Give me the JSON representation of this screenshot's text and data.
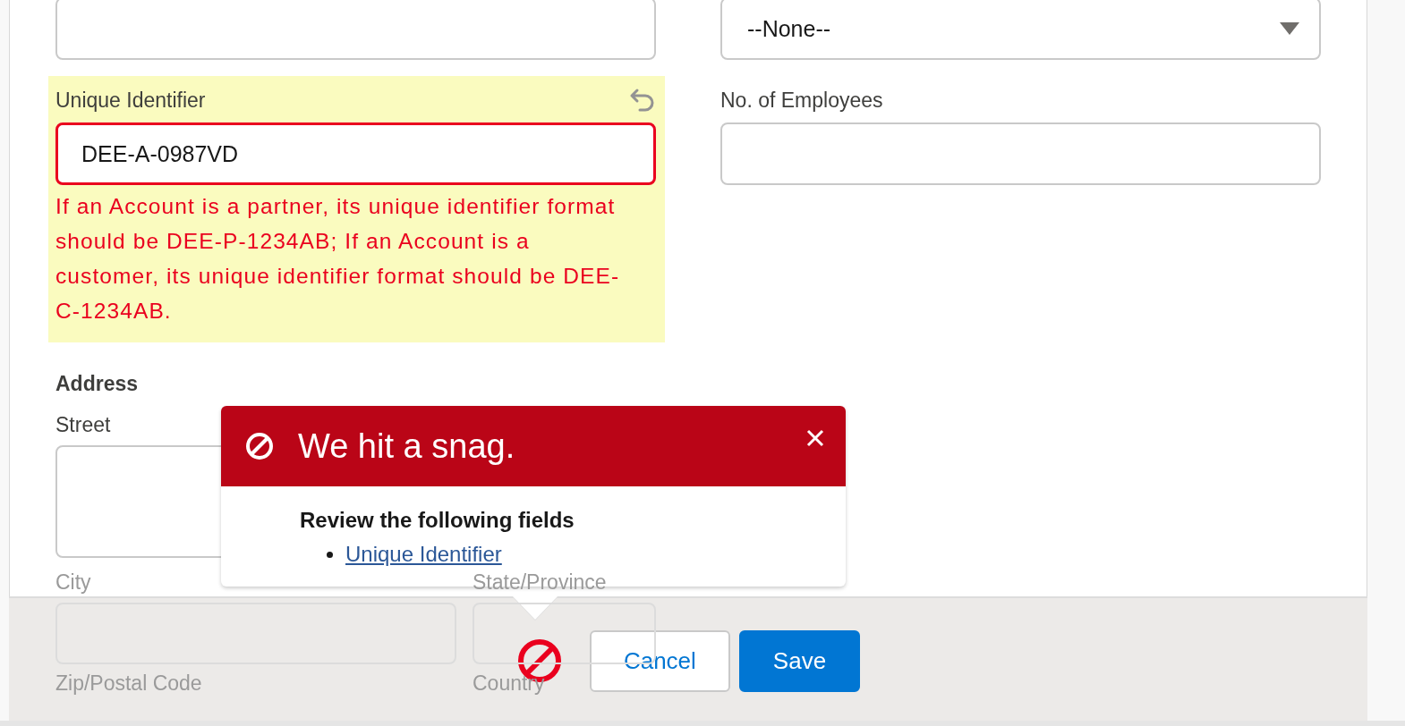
{
  "form": {
    "top_right_select": {
      "value": "--None--"
    },
    "unique_identifier": {
      "label": "Unique Identifier",
      "value": "DEE-A-0987VD",
      "changed": true,
      "invalid": true,
      "error": "If an Account is a partner, its unique identifier format should be DEE-P-1234AB; If an Account is a customer, its unique identifier format should be DEE-C-1234AB."
    },
    "employees": {
      "label": "No. of Employees"
    },
    "address": {
      "heading": "Address",
      "fields": [
        {
          "label": "Street",
          "kind": "textarea"
        },
        {
          "label": "City",
          "kind": "input",
          "dimmed": true
        },
        {
          "label": "State/Province",
          "kind": "input",
          "dimmed": true
        },
        {
          "label": "Zip/Postal Code",
          "kind": "label",
          "dimmed": true
        },
        {
          "label": "Country",
          "kind": "label",
          "dimmed": true
        }
      ]
    }
  },
  "error_popup": {
    "title": "We hit a snag.",
    "subtitle": "Review the following fields",
    "links": [
      "Unique Identifier"
    ]
  },
  "footer": {
    "has_error": true,
    "buttons": [
      {
        "label": "Cancel",
        "kind": "neutral"
      },
      {
        "label": "Save",
        "kind": "brand"
      }
    ]
  }
}
